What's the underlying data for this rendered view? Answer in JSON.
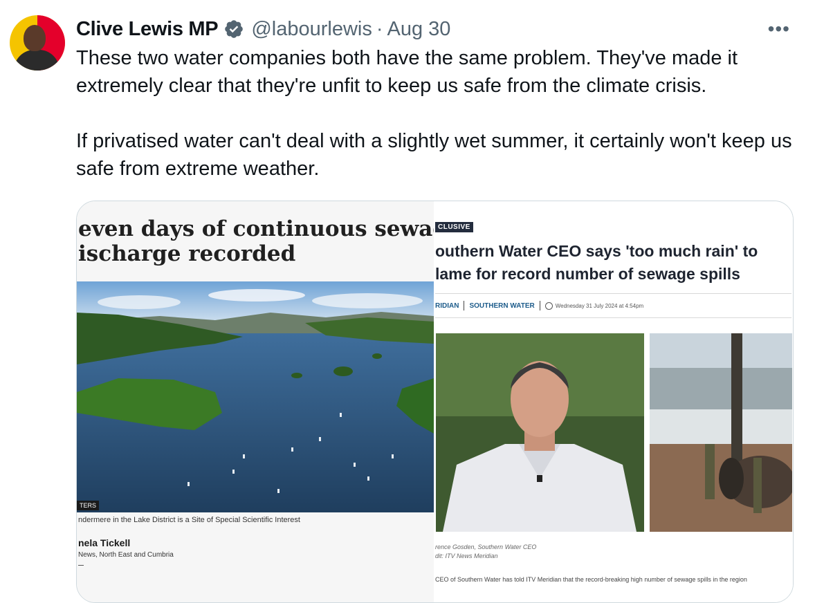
{
  "author": {
    "name": "Clive Lewis MP",
    "handle": "@labourlewis",
    "separator": "·",
    "date": "Aug 30",
    "more_label": "•••"
  },
  "tweet": {
    "paragraph1": "These two water companies both have the same problem. They've made it extremely clear that they're unfit to keep us safe from the climate crisis.",
    "paragraph2": "If privatised water can't deal with a slightly wet summer, it certainly won't keep us safe from extreme weather."
  },
  "left_article": {
    "headline_line1": "even days of continuous sewage",
    "headline_line2": "ischarge recorded",
    "credit_tag": "TERS",
    "caption": "ndermere in the Lake District is a Site of Special Scientific Interest",
    "author": "nela Tickell",
    "author_org": "News, North East and Cumbria"
  },
  "right_article": {
    "tag": "CLUSIVE",
    "headline_line1": "outhern Water CEO says 'too much rain' to",
    "headline_line2": "lame for record number of sewage spills",
    "meta_section1": "RIDIAN",
    "meta_section2": "SOUTHERN WATER",
    "meta_timestamp": "Wednesday 31 July 2024 at 4:54pm",
    "caption_line1": "rence Gosden, Southern Water CEO",
    "caption_line2": "dit: ITV News Meridian",
    "truncated_text": "CEO of Southern Water has told ITV Meridian that the record-breaking high number of sewage spills in the region"
  },
  "colors": {
    "text": "#0f1419",
    "secondary": "#536471",
    "verified_blue": "#1d9bf0",
    "card_border": "#cfd9de"
  }
}
